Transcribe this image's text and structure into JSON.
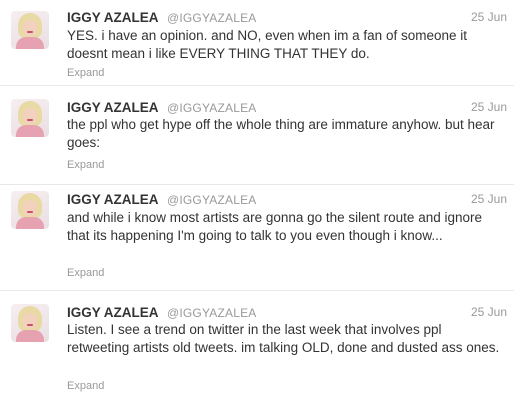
{
  "tweets": [
    {
      "name": "IGGY AZALEA",
      "handle": "@IGGYAZALEA",
      "date": "25 Jun",
      "text": "YES. i have an opinion. and NO, even when im a fan of someone it doesnt mean i like EVERY THING THAT THEY do.",
      "expand": "Expand"
    },
    {
      "name": "IGGY AZALEA",
      "handle": "@IGGYAZALEA",
      "date": "25 Jun",
      "text": "the ppl who get hype off the whole thing are immature anyhow. but hear goes:",
      "expand": "Expand"
    },
    {
      "name": "IGGY AZALEA",
      "handle": "@IGGYAZALEA",
      "date": "25 Jun",
      "text": "and while i know most artists are gonna go the silent route and ignore that its happening I'm going to talk to you even though i know...",
      "expand": "Expand"
    },
    {
      "name": "IGGY AZALEA",
      "handle": "@IGGYAZALEA",
      "date": "25 Jun",
      "text": "Listen. I see a trend on twitter in the last week that involves ppl retweeting artists old tweets. im talking OLD, done and dusted ass ones.",
      "expand": "Expand"
    }
  ]
}
